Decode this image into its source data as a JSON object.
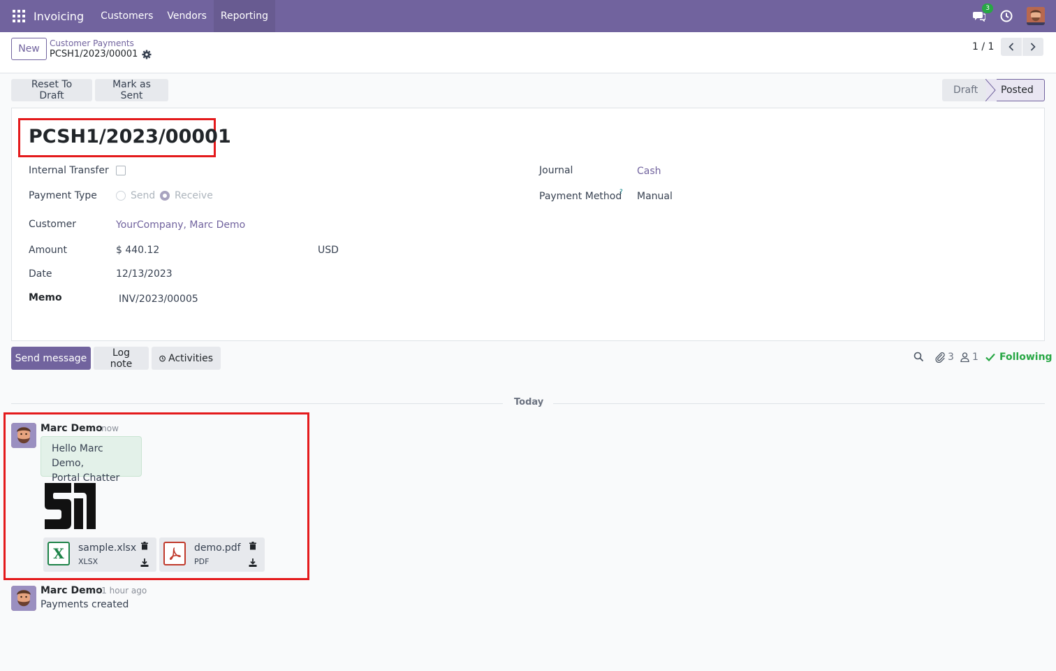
{
  "navbar": {
    "app_name": "Invoicing",
    "menu": [
      "Customers",
      "Vendors",
      "Reporting"
    ],
    "chat_count": "3"
  },
  "control_panel": {
    "new_label": "New",
    "breadcrumb_parent": "Customer Payments",
    "breadcrumb_current": "PCSH1/2023/00001",
    "pager": "1 / 1"
  },
  "statusbar": {
    "reset_label": "Reset To Draft",
    "mark_sent_label": "Mark as Sent",
    "stages": [
      "Draft",
      "Posted"
    ],
    "active_stage": "Posted"
  },
  "form": {
    "title": "PCSH1/2023/00001",
    "internal_transfer_label": "Internal Transfer",
    "internal_transfer_checked": false,
    "payment_type_label": "Payment Type",
    "payment_type_options": [
      "Send",
      "Receive"
    ],
    "payment_type_selected": "Receive",
    "customer_label": "Customer",
    "customer_value": "YourCompany, Marc Demo",
    "amount_label": "Amount",
    "amount_value": "$ 440.12",
    "currency_value": "USD",
    "date_label": "Date",
    "date_value": "12/13/2023",
    "memo_label": "Memo",
    "memo_value": "INV/2023/00005",
    "journal_label": "Journal",
    "journal_value": "Cash",
    "payment_method_label": "Payment Method",
    "payment_method_help": "?",
    "payment_method_value": "Manual"
  },
  "chatter": {
    "send_message_label": "Send message",
    "log_note_label": "Log note",
    "activities_label": "Activities",
    "attachments_count": "3",
    "followers_count": "1",
    "following_label": "Following",
    "separator_label": "Today",
    "messages": [
      {
        "author": "Marc Demo",
        "time": "- now",
        "body_lines": [
          "Hello Marc Demo,",
          "Portal Chatter"
        ],
        "attachments": [
          {
            "name": "sample.xlsx",
            "ext": "XLSX",
            "icon": "excel-icon",
            "icon_glyph": "X",
            "color": "#1d8348"
          },
          {
            "name": "demo.pdf",
            "ext": "PDF",
            "icon": "pdf-icon",
            "color": "#c0392b"
          }
        ]
      },
      {
        "author": "Marc Demo",
        "time": "- 1 hour ago",
        "body": "Payments created"
      }
    ]
  },
  "colors": {
    "brand": "#71639e",
    "highlight": "#e41a1c",
    "success": "#28a745",
    "link": "#71639e"
  }
}
